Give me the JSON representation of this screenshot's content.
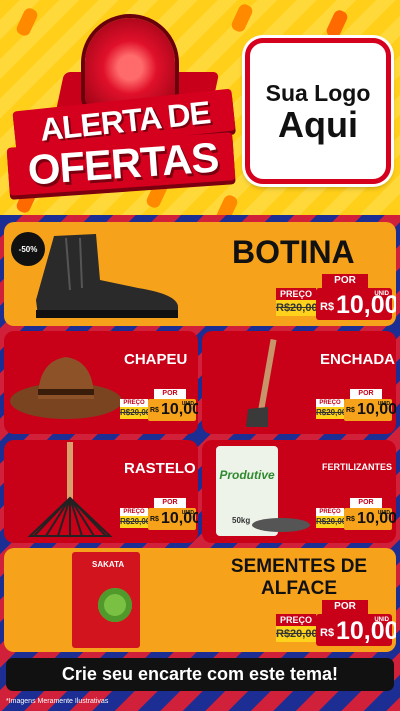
{
  "header": {
    "alerta": "ALERTA DE",
    "ofertas": "OFERTAS",
    "logo_line1": "Sua Logo",
    "logo_line2": "Aqui"
  },
  "products": [
    {
      "name": "BOTINA",
      "badge": "-50%",
      "por": "POR",
      "preco": "PREÇO",
      "old": "R$20,00",
      "currency": "R$",
      "price": "10,00",
      "unit": "UNID"
    },
    {
      "name": "CHAPEU",
      "por": "POR",
      "preco": "PREÇO",
      "old": "R$20,00",
      "currency": "R$",
      "price": "10,00",
      "unit": "UNID"
    },
    {
      "name": "ENCHADA",
      "por": "POR",
      "preco": "PREÇO",
      "old": "R$20,00",
      "currency": "R$",
      "price": "10,00",
      "unit": "UNID"
    },
    {
      "name": "RASTELO",
      "por": "POR",
      "preco": "PREÇO",
      "old": "R$20,00",
      "currency": "R$",
      "price": "10,00",
      "unit": "UNID"
    },
    {
      "name": "FERTILIZANTES",
      "por": "POR",
      "preco": "PREÇO",
      "old": "R$20,00",
      "currency": "R$",
      "price": "10,00",
      "unit": "UNID",
      "bag_brand": "Produtive",
      "bag_weight": "50kg"
    },
    {
      "name": "SEMENTES DE ALFACE",
      "name_l1": "SEMENTES DE",
      "name_l2": "ALFACE",
      "por": "POR",
      "preco": "PREÇO",
      "old": "R$20,00",
      "currency": "R$",
      "price": "10,00",
      "unit": "UNID",
      "pack_brand": "SAKATA"
    }
  ],
  "cta": "Crie seu encarte com este tema!",
  "note": "*Imagens Meramente Ilustrativas",
  "colors": {
    "yellow": "#ffcf1a",
    "red": "#c80018",
    "orange": "#f7a21b",
    "blue": "#1c2d94"
  }
}
